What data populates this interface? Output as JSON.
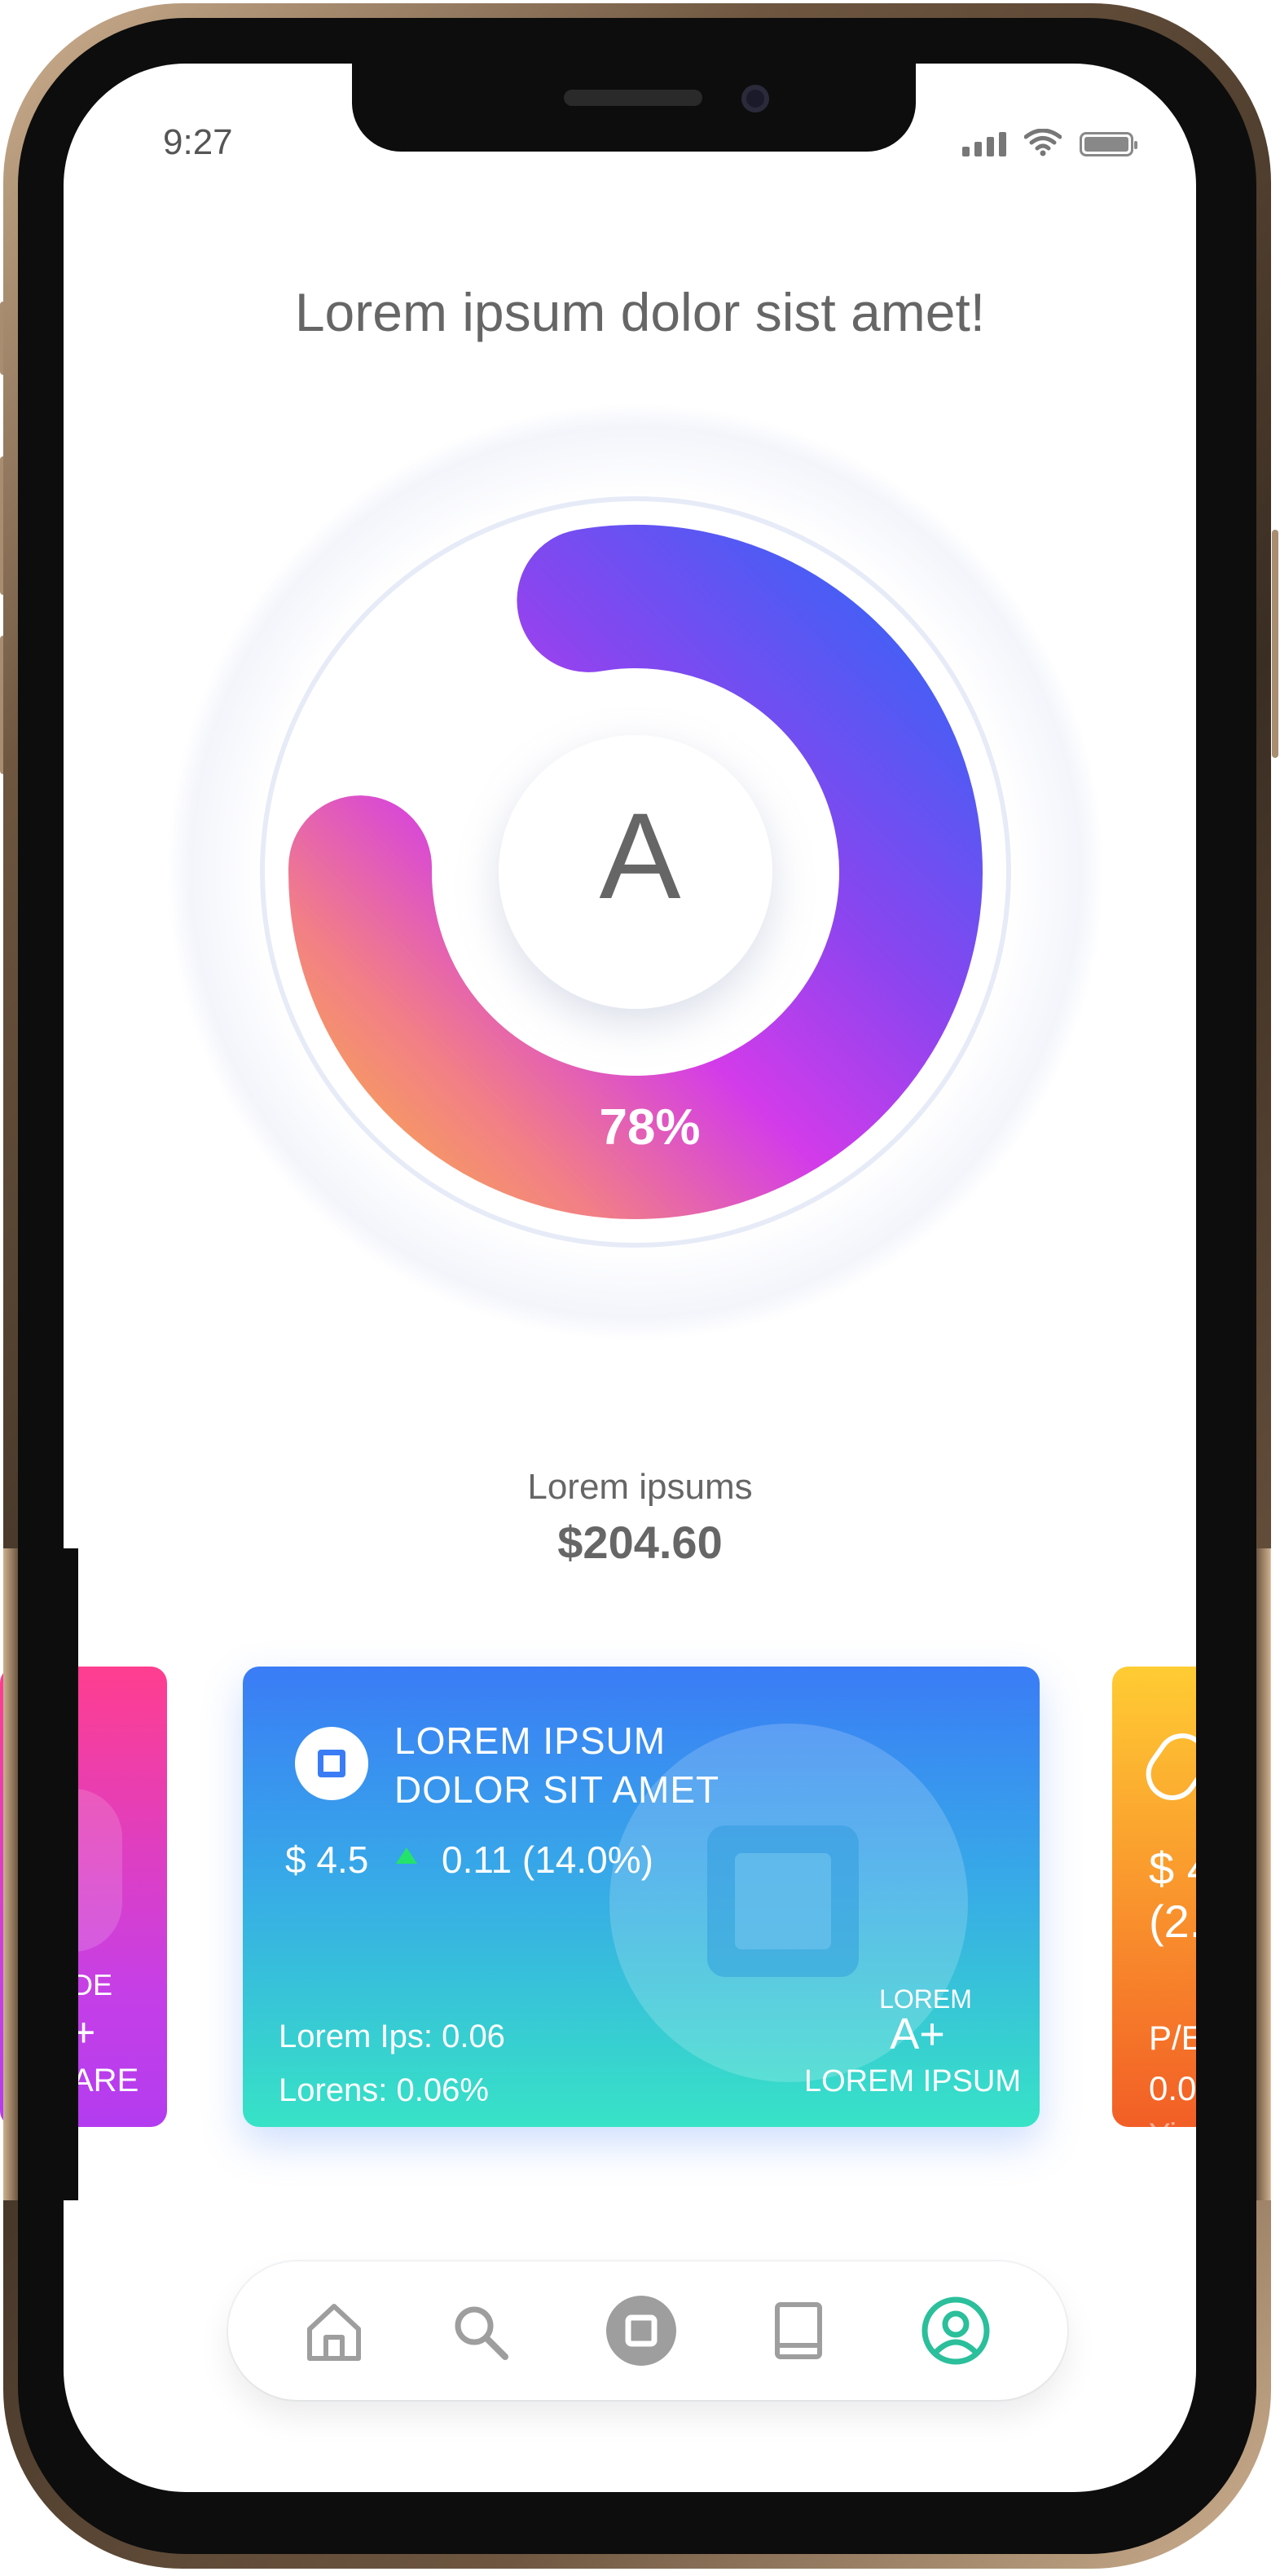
{
  "status_bar": {
    "time": "9:27"
  },
  "headline": "Lorem ipsum dolor sist amet!",
  "score_ring": {
    "grade": "A",
    "percent_label": "78%",
    "percent_value": 0.78,
    "gradient_colors": [
      "#4a5cf6",
      "#d13bee",
      "#f59b66",
      "#e052c6"
    ]
  },
  "summary": {
    "label": "Lorem ipsums",
    "value": "$204.60"
  },
  "cards": {
    "left": {
      "line1": "DE",
      "line2": "+",
      "line3": "ARE"
    },
    "main": {
      "title_line1": "LOREM IPSUM",
      "title_line2": "DOLOR SIT AMET",
      "price": "$ 4.5",
      "change": "0.11 (14.0%)",
      "stat1": "Lorem Ips: 0.06",
      "stat2": "Lorens: 0.06%",
      "grade_label": "LOREM",
      "grade": "A+",
      "grade_caption": "LOREM IPSUM"
    },
    "right": {
      "line1": "$ 4",
      "line2": "(2.",
      "line3": "P/E",
      "line4": "0.0",
      "line5": "Yie"
    }
  },
  "nav": {
    "items": [
      {
        "icon": "home-icon"
      },
      {
        "icon": "search-icon"
      },
      {
        "icon": "center-square-icon"
      },
      {
        "icon": "book-icon"
      },
      {
        "icon": "profile-icon",
        "active": true
      }
    ],
    "active_color": "#2bbf9b",
    "inactive_color": "#9e9e9e"
  }
}
